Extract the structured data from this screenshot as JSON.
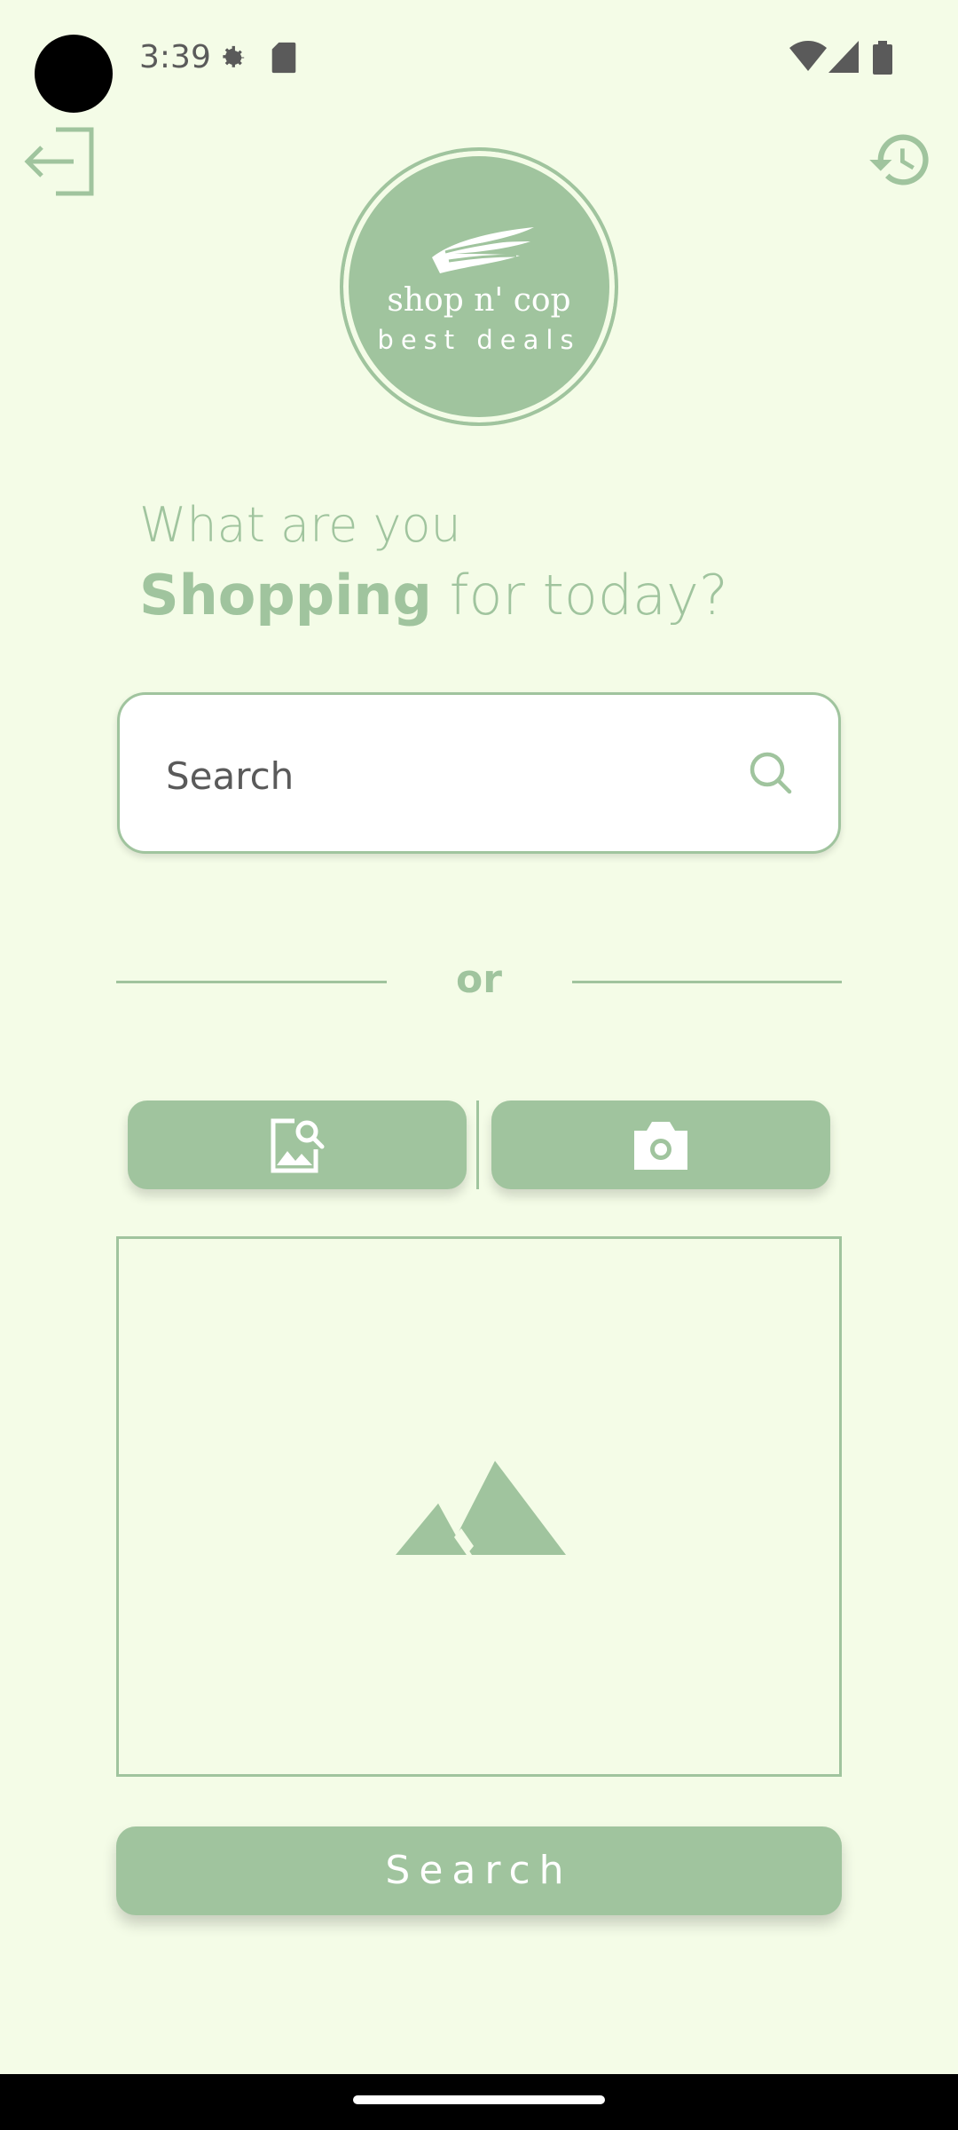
{
  "status_bar": {
    "time": "3:39",
    "icons": [
      "settings-gear-icon",
      "sd-card-icon",
      "wifi-icon",
      "cell-signal-icon",
      "battery-icon"
    ]
  },
  "header": {
    "logout_icon": "logout-icon",
    "history_icon": "history-icon"
  },
  "logo": {
    "line1": "shop n' cop",
    "line2": "best deals"
  },
  "headline": {
    "line1": "What are you",
    "bold": "Shopping",
    "rest": " for today?"
  },
  "search": {
    "placeholder": "Search",
    "value": ""
  },
  "divider_text": "or",
  "image_buttons": {
    "gallery_icon": "image-search-icon",
    "camera_icon": "camera-icon"
  },
  "preview": {
    "icon": "mountain-placeholder-icon"
  },
  "search_button_label": "Search",
  "colors": {
    "background": "#F4FCE7",
    "accent": "#A0C49E",
    "text_gray": "#5A5A5A"
  }
}
